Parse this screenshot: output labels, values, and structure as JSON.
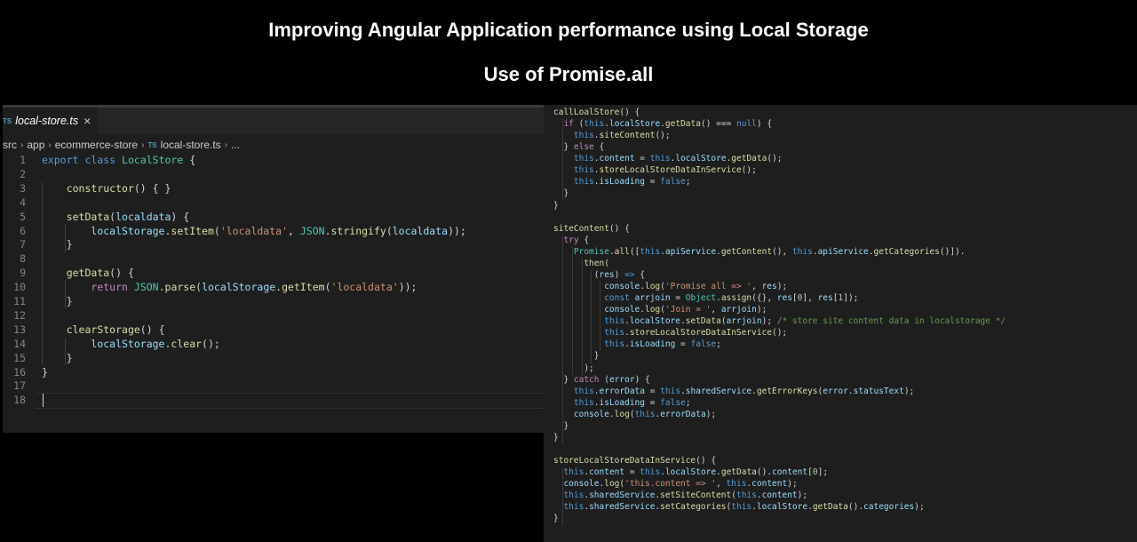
{
  "header": {
    "title": "Improving Angular Application performance using Local Storage",
    "subtitle": "Use of Promise.all"
  },
  "editor": {
    "tab": {
      "badge": "TS",
      "filename": "local-store.ts",
      "close_glyph": "×"
    },
    "breadcrumb": {
      "items": [
        "src",
        "app",
        "ecommerce-store",
        "local-store.ts",
        "..."
      ],
      "file_badge": "TS",
      "separator": "›"
    },
    "line_numbers": [
      "1",
      "2",
      "3",
      "4",
      "5",
      "6",
      "7",
      "8",
      "9",
      "10",
      "11",
      "12",
      "13",
      "14",
      "15",
      "16",
      "17",
      "18"
    ],
    "lines": [
      [
        [
          "kw",
          "export"
        ],
        [
          "pl",
          " "
        ],
        [
          "kw",
          "class"
        ],
        [
          "pl",
          " "
        ],
        [
          "cls",
          "LocalStore"
        ],
        [
          "pl",
          " {"
        ]
      ],
      [],
      [
        [
          "pl",
          "    "
        ],
        [
          "fn",
          "constructor"
        ],
        [
          "pl",
          "() { }"
        ]
      ],
      [],
      [
        [
          "pl",
          "    "
        ],
        [
          "fn",
          "setData"
        ],
        [
          "pl",
          "("
        ],
        [
          "var",
          "localdata"
        ],
        [
          "pl",
          ") {"
        ]
      ],
      [
        [
          "pl",
          "        "
        ],
        [
          "var",
          "localStorage"
        ],
        [
          "pl",
          "."
        ],
        [
          "fn",
          "setItem"
        ],
        [
          "pl",
          "("
        ],
        [
          "str",
          "'localdata'"
        ],
        [
          "pl",
          ", "
        ],
        [
          "cls",
          "JSON"
        ],
        [
          "pl",
          "."
        ],
        [
          "fn",
          "stringify"
        ],
        [
          "pl",
          "("
        ],
        [
          "var",
          "localdata"
        ],
        [
          "pl",
          "));"
        ]
      ],
      [
        [
          "pl",
          "    }"
        ]
      ],
      [],
      [
        [
          "pl",
          "    "
        ],
        [
          "fn",
          "getData"
        ],
        [
          "pl",
          "() {"
        ]
      ],
      [
        [
          "pl",
          "        "
        ],
        [
          "kw2",
          "return"
        ],
        [
          "pl",
          " "
        ],
        [
          "cls",
          "JSON"
        ],
        [
          "pl",
          "."
        ],
        [
          "fn",
          "parse"
        ],
        [
          "pl",
          "("
        ],
        [
          "var",
          "localStorage"
        ],
        [
          "pl",
          "."
        ],
        [
          "fn",
          "getItem"
        ],
        [
          "pl",
          "("
        ],
        [
          "str",
          "'localdata'"
        ],
        [
          "pl",
          "));"
        ]
      ],
      [
        [
          "pl",
          "    }"
        ]
      ],
      [],
      [
        [
          "pl",
          "    "
        ],
        [
          "fn",
          "clearStorage"
        ],
        [
          "pl",
          "() {"
        ]
      ],
      [
        [
          "pl",
          "        "
        ],
        [
          "var",
          "localStorage"
        ],
        [
          "pl",
          "."
        ],
        [
          "fn",
          "clear"
        ],
        [
          "pl",
          "();"
        ]
      ],
      [
        [
          "pl",
          "    }"
        ]
      ],
      [
        [
          "pl",
          "}"
        ]
      ],
      [],
      []
    ]
  },
  "snippet": {
    "lines": [
      [
        [
          "fn",
          "callLoalStore"
        ],
        [
          "pl",
          "() {"
        ]
      ],
      [
        [
          "pl",
          "  "
        ],
        [
          "kw2",
          "if"
        ],
        [
          "pl",
          " ("
        ],
        [
          "kw",
          "this"
        ],
        [
          "pl",
          "."
        ],
        [
          "var",
          "localStore"
        ],
        [
          "pl",
          "."
        ],
        [
          "fn",
          "getData"
        ],
        [
          "pl",
          "() === "
        ],
        [
          "kw",
          "null"
        ],
        [
          "pl",
          ") {"
        ]
      ],
      [
        [
          "pl",
          "    "
        ],
        [
          "kw",
          "this"
        ],
        [
          "pl",
          "."
        ],
        [
          "fn",
          "siteContent"
        ],
        [
          "pl",
          "();"
        ]
      ],
      [
        [
          "pl",
          "  } "
        ],
        [
          "kw2",
          "else"
        ],
        [
          "pl",
          " {"
        ]
      ],
      [
        [
          "pl",
          "    "
        ],
        [
          "kw",
          "this"
        ],
        [
          "pl",
          "."
        ],
        [
          "var",
          "content"
        ],
        [
          "pl",
          " = "
        ],
        [
          "kw",
          "this"
        ],
        [
          "pl",
          "."
        ],
        [
          "var",
          "localStore"
        ],
        [
          "pl",
          "."
        ],
        [
          "fn",
          "getData"
        ],
        [
          "pl",
          "();"
        ]
      ],
      [
        [
          "pl",
          "    "
        ],
        [
          "kw",
          "this"
        ],
        [
          "pl",
          "."
        ],
        [
          "fn",
          "storeLocalStoreDataInService"
        ],
        [
          "pl",
          "();"
        ]
      ],
      [
        [
          "pl",
          "    "
        ],
        [
          "kw",
          "this"
        ],
        [
          "pl",
          "."
        ],
        [
          "var",
          "isLoading"
        ],
        [
          "pl",
          " = "
        ],
        [
          "kw",
          "false"
        ],
        [
          "pl",
          ";"
        ]
      ],
      [
        [
          "pl",
          "  }"
        ]
      ],
      [
        [
          "pl",
          "}"
        ]
      ],
      [],
      [
        [
          "fn",
          "siteContent"
        ],
        [
          "pl",
          "() {"
        ]
      ],
      [
        [
          "pl",
          "  "
        ],
        [
          "kw2",
          "try"
        ],
        [
          "pl",
          " {"
        ]
      ],
      [
        [
          "pl",
          "    "
        ],
        [
          "cls",
          "Promise"
        ],
        [
          "pl",
          "."
        ],
        [
          "fn",
          "all"
        ],
        [
          "pl",
          "(["
        ],
        [
          "kw",
          "this"
        ],
        [
          "pl",
          "."
        ],
        [
          "var",
          "apiService"
        ],
        [
          "pl",
          "."
        ],
        [
          "fn",
          "getContent"
        ],
        [
          "pl",
          "(), "
        ],
        [
          "kw",
          "this"
        ],
        [
          "pl",
          "."
        ],
        [
          "var",
          "apiService"
        ],
        [
          "pl",
          "."
        ],
        [
          "fn",
          "getCategories"
        ],
        [
          "pl",
          "()])."
        ]
      ],
      [
        [
          "pl",
          "      "
        ],
        [
          "fn",
          "then"
        ],
        [
          "pl",
          "("
        ]
      ],
      [
        [
          "pl",
          "        ("
        ],
        [
          "var",
          "res"
        ],
        [
          "pl",
          ") "
        ],
        [
          "kw",
          "=>"
        ],
        [
          "pl",
          " {"
        ]
      ],
      [
        [
          "pl",
          "          "
        ],
        [
          "var",
          "console"
        ],
        [
          "pl",
          "."
        ],
        [
          "fn",
          "log"
        ],
        [
          "pl",
          "("
        ],
        [
          "str",
          "'Promise all => '"
        ],
        [
          "pl",
          ", "
        ],
        [
          "var",
          "res"
        ],
        [
          "pl",
          ");"
        ]
      ],
      [
        [
          "pl",
          "          "
        ],
        [
          "kw",
          "const"
        ],
        [
          "pl",
          " "
        ],
        [
          "var",
          "arrjoin"
        ],
        [
          "pl",
          " = "
        ],
        [
          "cls",
          "Object"
        ],
        [
          "pl",
          "."
        ],
        [
          "fn",
          "assign"
        ],
        [
          "pl",
          "({}, "
        ],
        [
          "var",
          "res"
        ],
        [
          "pl",
          "["
        ],
        [
          "num",
          "0"
        ],
        [
          "pl",
          "], "
        ],
        [
          "var",
          "res"
        ],
        [
          "pl",
          "["
        ],
        [
          "num",
          "1"
        ],
        [
          "pl",
          "]);"
        ]
      ],
      [
        [
          "pl",
          "          "
        ],
        [
          "var",
          "console"
        ],
        [
          "pl",
          "."
        ],
        [
          "fn",
          "log"
        ],
        [
          "pl",
          "("
        ],
        [
          "str",
          "'Join = '"
        ],
        [
          "pl",
          ", "
        ],
        [
          "var",
          "arrjoin"
        ],
        [
          "pl",
          ");"
        ]
      ],
      [
        [
          "pl",
          "          "
        ],
        [
          "kw",
          "this"
        ],
        [
          "pl",
          "."
        ],
        [
          "var",
          "localStore"
        ],
        [
          "pl",
          "."
        ],
        [
          "fn",
          "setData"
        ],
        [
          "pl",
          "("
        ],
        [
          "var",
          "arrjoin"
        ],
        [
          "pl",
          "); "
        ],
        [
          "cmt",
          "/* store site content data in localstorage */"
        ]
      ],
      [
        [
          "pl",
          "          "
        ],
        [
          "kw",
          "this"
        ],
        [
          "pl",
          "."
        ],
        [
          "fn",
          "storeLocalStoreDataInService"
        ],
        [
          "pl",
          "();"
        ]
      ],
      [
        [
          "pl",
          "          "
        ],
        [
          "kw",
          "this"
        ],
        [
          "pl",
          "."
        ],
        [
          "var",
          "isLoading"
        ],
        [
          "pl",
          " = "
        ],
        [
          "kw",
          "false"
        ],
        [
          "pl",
          ";"
        ]
      ],
      [
        [
          "pl",
          "        }"
        ]
      ],
      [
        [
          "pl",
          "      );"
        ]
      ],
      [
        [
          "pl",
          "  } "
        ],
        [
          "kw2",
          "catch"
        ],
        [
          "pl",
          " ("
        ],
        [
          "var",
          "error"
        ],
        [
          "pl",
          ") {"
        ]
      ],
      [
        [
          "pl",
          "    "
        ],
        [
          "kw",
          "this"
        ],
        [
          "pl",
          "."
        ],
        [
          "var",
          "errorData"
        ],
        [
          "pl",
          " = "
        ],
        [
          "kw",
          "this"
        ],
        [
          "pl",
          "."
        ],
        [
          "var",
          "sharedService"
        ],
        [
          "pl",
          "."
        ],
        [
          "fn",
          "getErrorKeys"
        ],
        [
          "pl",
          "("
        ],
        [
          "var",
          "error"
        ],
        [
          "pl",
          "."
        ],
        [
          "var",
          "statusText"
        ],
        [
          "pl",
          ");"
        ]
      ],
      [
        [
          "pl",
          "    "
        ],
        [
          "kw",
          "this"
        ],
        [
          "pl",
          "."
        ],
        [
          "var",
          "isLoading"
        ],
        [
          "pl",
          " = "
        ],
        [
          "kw",
          "false"
        ],
        [
          "pl",
          ";"
        ]
      ],
      [
        [
          "pl",
          "    "
        ],
        [
          "var",
          "console"
        ],
        [
          "pl",
          "."
        ],
        [
          "fn",
          "log"
        ],
        [
          "pl",
          "("
        ],
        [
          "kw",
          "this"
        ],
        [
          "pl",
          "."
        ],
        [
          "var",
          "errorData"
        ],
        [
          "pl",
          ");"
        ]
      ],
      [
        [
          "pl",
          "  }"
        ]
      ],
      [
        [
          "pl",
          "}"
        ]
      ],
      [],
      [
        [
          "fn",
          "storeLocalStoreDataInService"
        ],
        [
          "pl",
          "() {"
        ]
      ],
      [
        [
          "pl",
          "  "
        ],
        [
          "kw",
          "this"
        ],
        [
          "pl",
          "."
        ],
        [
          "var",
          "content"
        ],
        [
          "pl",
          " = "
        ],
        [
          "kw",
          "this"
        ],
        [
          "pl",
          "."
        ],
        [
          "var",
          "localStore"
        ],
        [
          "pl",
          "."
        ],
        [
          "fn",
          "getData"
        ],
        [
          "pl",
          "()."
        ],
        [
          "var",
          "content"
        ],
        [
          "pl",
          "["
        ],
        [
          "num",
          "0"
        ],
        [
          "pl",
          "];"
        ]
      ],
      [
        [
          "pl",
          "  "
        ],
        [
          "var",
          "console"
        ],
        [
          "pl",
          "."
        ],
        [
          "fn",
          "log"
        ],
        [
          "pl",
          "("
        ],
        [
          "str",
          "'this.content => '"
        ],
        [
          "pl",
          ", "
        ],
        [
          "kw",
          "this"
        ],
        [
          "pl",
          "."
        ],
        [
          "var",
          "content"
        ],
        [
          "pl",
          ");"
        ]
      ],
      [
        [
          "pl",
          "  "
        ],
        [
          "kw",
          "this"
        ],
        [
          "pl",
          "."
        ],
        [
          "var",
          "sharedService"
        ],
        [
          "pl",
          "."
        ],
        [
          "fn",
          "setSiteContent"
        ],
        [
          "pl",
          "("
        ],
        [
          "kw",
          "this"
        ],
        [
          "pl",
          "."
        ],
        [
          "var",
          "content"
        ],
        [
          "pl",
          ");"
        ]
      ],
      [
        [
          "pl",
          "  "
        ],
        [
          "kw",
          "this"
        ],
        [
          "pl",
          "."
        ],
        [
          "var",
          "sharedService"
        ],
        [
          "pl",
          "."
        ],
        [
          "fn",
          "setCategories"
        ],
        [
          "pl",
          "("
        ],
        [
          "kw",
          "this"
        ],
        [
          "pl",
          "."
        ],
        [
          "var",
          "localStore"
        ],
        [
          "pl",
          "."
        ],
        [
          "fn",
          "getData"
        ],
        [
          "pl",
          "()."
        ],
        [
          "var",
          "categories"
        ],
        [
          "pl",
          ");"
        ]
      ],
      [
        [
          "pl",
          "}"
        ]
      ]
    ]
  }
}
